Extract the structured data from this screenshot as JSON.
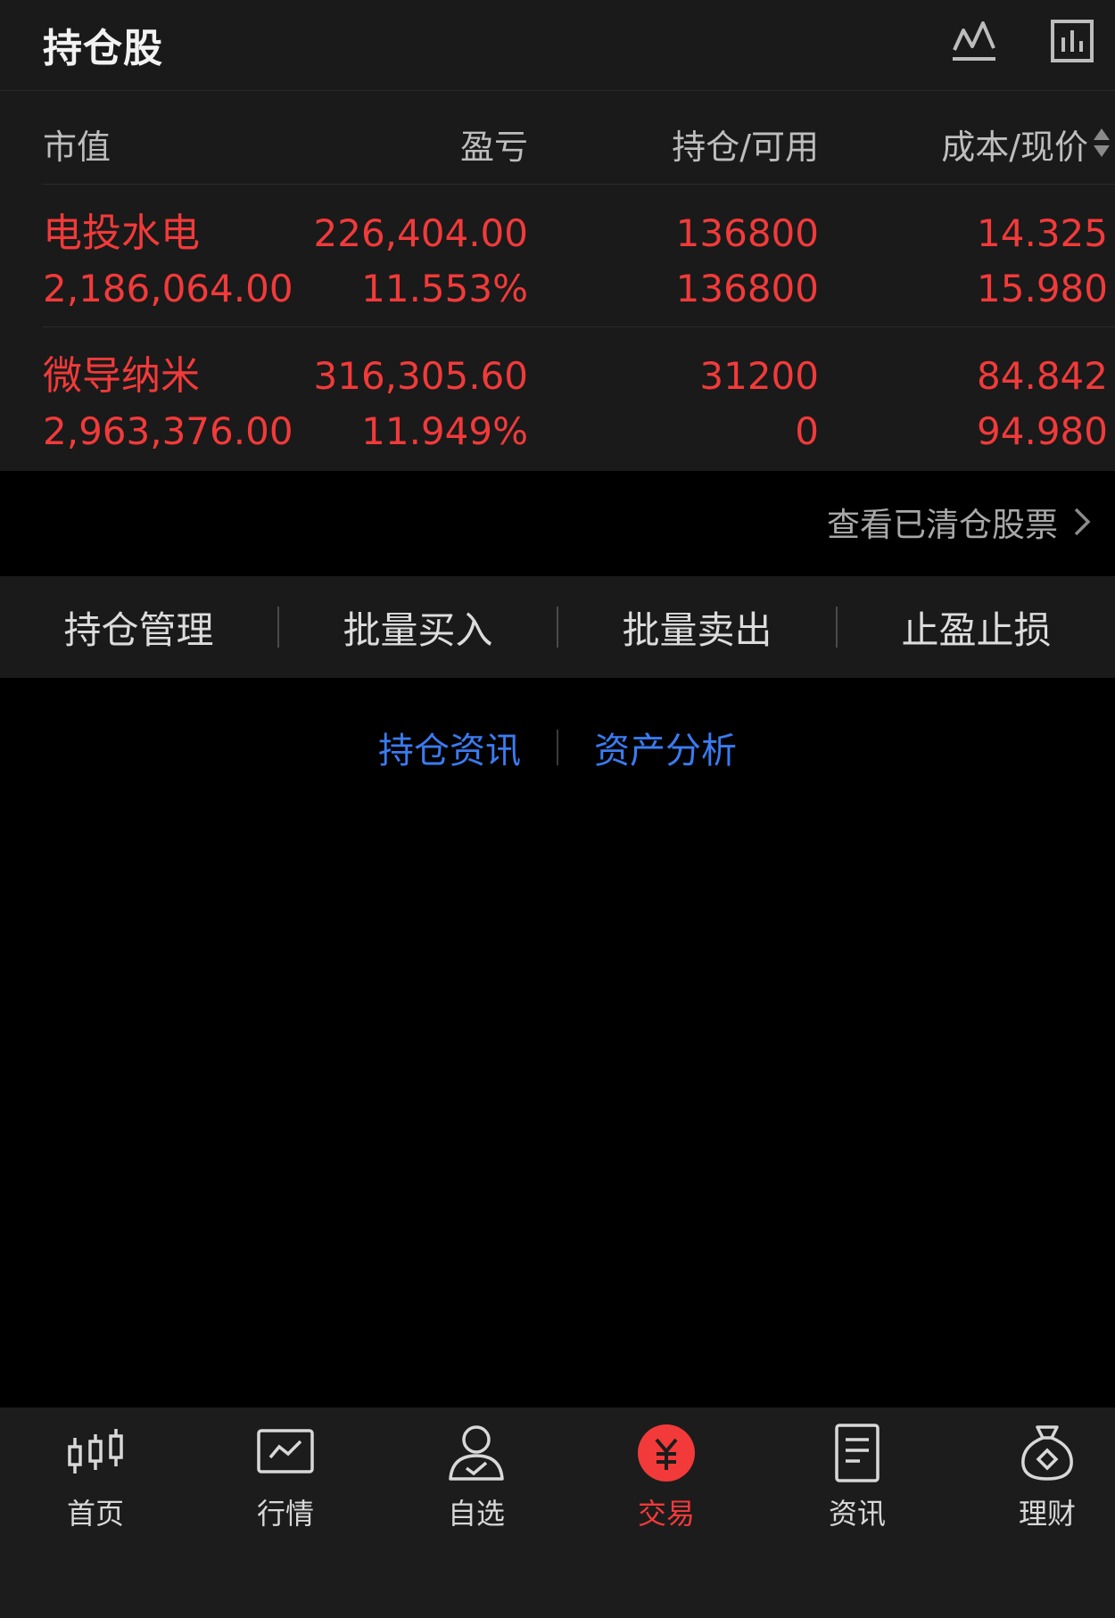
{
  "header": {
    "title": "持仓股"
  },
  "table": {
    "columns": [
      "市值",
      "盈亏",
      "持仓/可用",
      "成本/现价"
    ],
    "rows": [
      {
        "name": "电投水电",
        "market_value": "2,186,064.00",
        "pl_amount": "226,404.00",
        "pl_pct": "11.553%",
        "holding": "136800",
        "available": "136800",
        "cost": "14.325",
        "price": "15.980"
      },
      {
        "name": "微导纳米",
        "market_value": "2,963,376.00",
        "pl_amount": "316,305.60",
        "pl_pct": "11.949%",
        "holding": "31200",
        "available": "0",
        "cost": "84.842",
        "price": "94.980"
      }
    ]
  },
  "cleared_link": "查看已清仓股票",
  "actions": [
    "持仓管理",
    "批量买入",
    "批量卖出",
    "止盈止损"
  ],
  "info_links": [
    "持仓资讯",
    "资产分析"
  ],
  "nav": [
    {
      "label": "首页",
      "icon": "candlestick-icon"
    },
    {
      "label": "行情",
      "icon": "market-chart-icon"
    },
    {
      "label": "自选",
      "icon": "watchlist-user-icon"
    },
    {
      "label": "交易",
      "icon": "yuan-trade-icon",
      "active": true
    },
    {
      "label": "资讯",
      "icon": "news-document-icon"
    },
    {
      "label": "理财",
      "icon": "money-bag-icon"
    }
  ],
  "colors": {
    "background": "#000000",
    "panel": "#1a1a1a",
    "profit_red": "#f23a3a",
    "link_blue": "#3a7bf0"
  }
}
